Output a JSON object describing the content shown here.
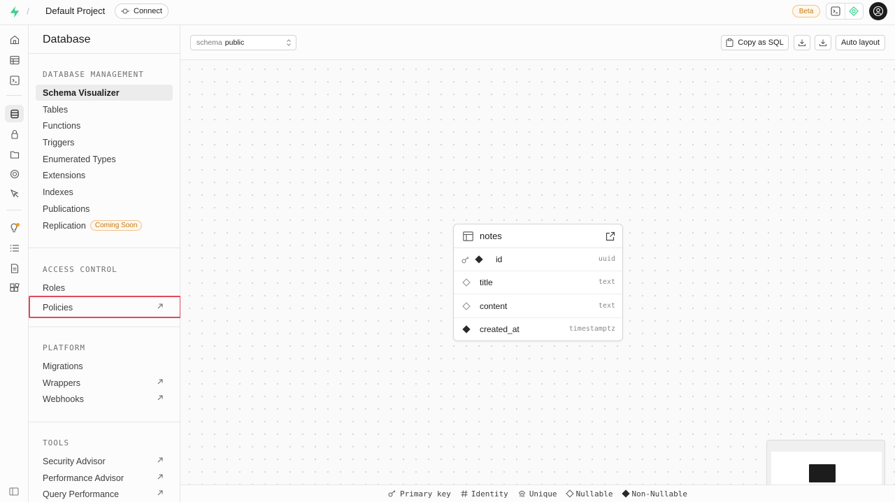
{
  "header": {
    "separator": "/",
    "project_name": "Default Project",
    "connect_label": "Connect",
    "beta_label": "Beta",
    "brand_color": "#3ecf8e"
  },
  "sidebar": {
    "title": "Database",
    "sections": [
      {
        "heading": "DATABASE MANAGEMENT",
        "items": [
          {
            "label": "Schema Visualizer",
            "active": true
          },
          {
            "label": "Tables"
          },
          {
            "label": "Functions"
          },
          {
            "label": "Triggers"
          },
          {
            "label": "Enumerated Types"
          },
          {
            "label": "Extensions"
          },
          {
            "label": "Indexes"
          },
          {
            "label": "Publications"
          },
          {
            "label": "Replication",
            "badge": "Coming Soon"
          }
        ]
      },
      {
        "heading": "ACCESS CONTROL",
        "items": [
          {
            "label": "Roles"
          },
          {
            "label": "Policies",
            "external": true,
            "highlighted": true
          }
        ]
      },
      {
        "heading": "PLATFORM",
        "items": [
          {
            "label": "Migrations"
          },
          {
            "label": "Wrappers",
            "external": true
          },
          {
            "label": "Webhooks",
            "external": true
          }
        ]
      },
      {
        "heading": "TOOLS",
        "items": [
          {
            "label": "Security Advisor",
            "external": true
          },
          {
            "label": "Performance Advisor",
            "external": true
          },
          {
            "label": "Query Performance",
            "external": true
          }
        ]
      }
    ]
  },
  "toolbar": {
    "schema_prefix": "schema",
    "schema_value": "public",
    "copy_sql_label": "Copy as SQL",
    "auto_layout_label": "Auto layout"
  },
  "table": {
    "name": "notes",
    "columns": [
      {
        "name": "id",
        "type": "uuid",
        "primary_key": true,
        "nullable": false
      },
      {
        "name": "title",
        "type": "text",
        "nullable": true
      },
      {
        "name": "content",
        "type": "text",
        "nullable": true
      },
      {
        "name": "created_at",
        "type": "timestamptz",
        "nullable": false
      }
    ]
  },
  "legend": {
    "primary_key": "Primary key",
    "identity": "Identity",
    "unique": "Unique",
    "nullable": "Nullable",
    "non_nullable": "Non-Nullable"
  }
}
